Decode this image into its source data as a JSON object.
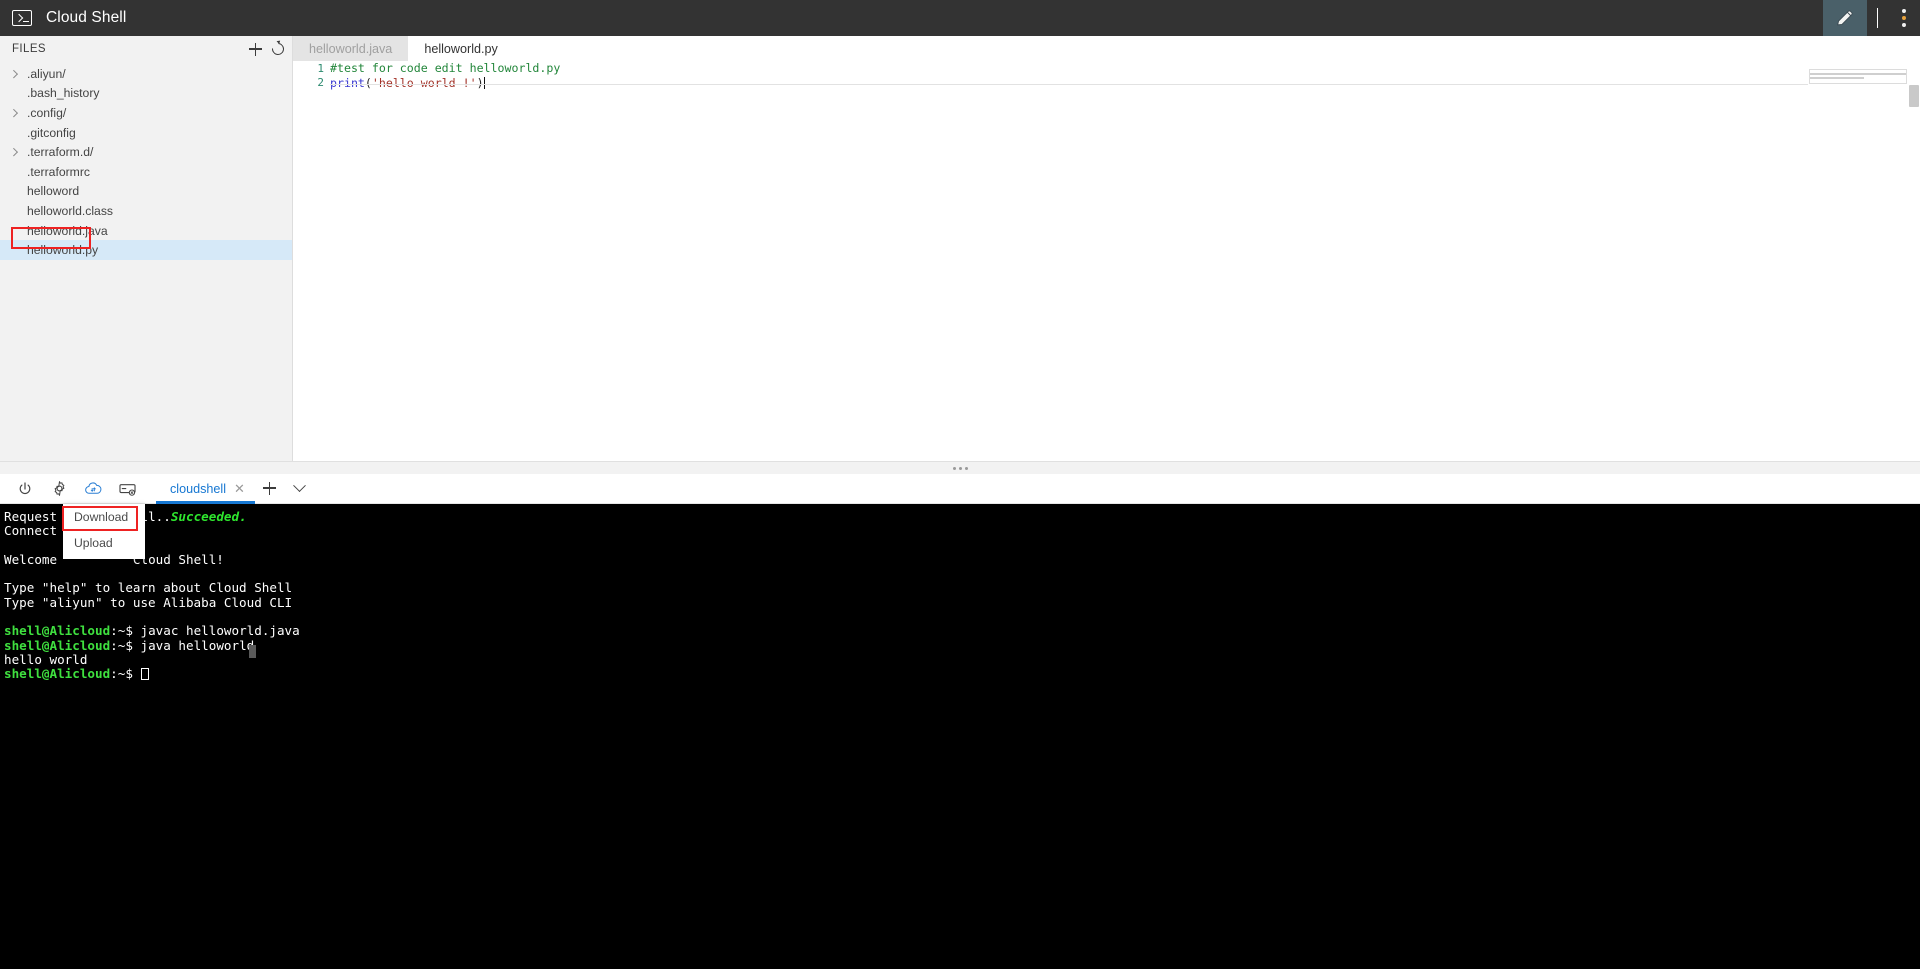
{
  "header": {
    "title": "Cloud Shell",
    "logo_icon": "terminal-icon",
    "edit_icon": "pencil-icon",
    "more_icon": "kebab-menu-icon"
  },
  "sidebar": {
    "label": "FILES",
    "add_icon": "plus-icon",
    "refresh_icon": "refresh-icon",
    "selected_file": "helloworld.py",
    "files": [
      {
        "name": ".aliyun/",
        "expandable": true,
        "selected": false
      },
      {
        "name": ".bash_history",
        "expandable": false,
        "selected": false
      },
      {
        "name": ".config/",
        "expandable": true,
        "selected": false
      },
      {
        "name": ".gitconfig",
        "expandable": false,
        "selected": false
      },
      {
        "name": ".terraform.d/",
        "expandable": true,
        "selected": false
      },
      {
        "name": ".terraformrc",
        "expandable": false,
        "selected": false
      },
      {
        "name": "helloword",
        "expandable": false,
        "selected": false
      },
      {
        "name": "helloworld.class",
        "expandable": false,
        "selected": false
      },
      {
        "name": "helloworld.java",
        "expandable": false,
        "selected": false
      },
      {
        "name": "helloworld.py",
        "expandable": false,
        "selected": true
      }
    ]
  },
  "editor": {
    "tabs": [
      {
        "label": "helloworld.java",
        "active": false
      },
      {
        "label": "helloworld.py",
        "active": true
      }
    ],
    "lines": [
      {
        "number": "1",
        "comment": "#test for code edit helloworld.py"
      },
      {
        "number": "2",
        "fn": "print",
        "open": "(",
        "string": "'hello world !'",
        "close": ")"
      }
    ]
  },
  "terminal_toolbar": {
    "buttons": [
      {
        "icon": "power-icon",
        "name": "power-button"
      },
      {
        "icon": "gear-icon",
        "name": "settings-button"
      },
      {
        "icon": "cloud-transfer-icon",
        "name": "file-transfer-button"
      },
      {
        "icon": "storage-icon",
        "name": "storage-button"
      }
    ],
    "tab_label": "cloudshell",
    "tab_close_icon": "close-icon",
    "add_icon": "plus-icon",
    "chevron_icon": "chevron-down-icon"
  },
  "dropdown": {
    "items": [
      {
        "label": "Download",
        "highlighted": true
      },
      {
        "label": "Upload",
        "highlighted": false
      }
    ]
  },
  "terminal": {
    "line1_pre": "Request",
    "line1_mid": "Shell..",
    "line1_status": "Succeeded.",
    "line2": "Connect",
    "line3": "Welcome",
    "line3_tail": "Cloud Shell!",
    "line_help": "Type \"help\" to learn about Cloud Shell",
    "line_cli": "Type \"aliyun\" to use Alibaba Cloud CLI",
    "prompt": "shell@Alicloud",
    "path": ":~$",
    "cmd1": "javac helloworld.java",
    "cmd2": "java helloworld",
    "output1": "hello world"
  },
  "colors": {
    "header_bg": "#333333",
    "sidebar_bg": "#f2f2f2",
    "selection_bg": "#d6e9f8",
    "annotation": "#ee2222",
    "accent_blue": "#1677d2",
    "terminal_bg": "#000000",
    "prompt_green": "#3fe03f"
  }
}
